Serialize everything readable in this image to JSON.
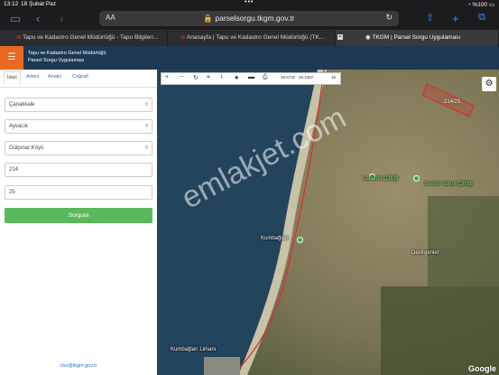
{
  "status": {
    "time": "13:12",
    "date": "18 Şubat Paz",
    "battery": "%100"
  },
  "browser": {
    "aa": "AA",
    "url": "parselsorgu.tkgm.gov.tr",
    "tabs": [
      "Tapu ve Kadastro Genel Müdürlüğü - Tapu Bilgileri...",
      "Anasayfa | Tapu ve Kadastro Genel Müdürlüğü (TK...",
      "TKGM | Parsel Sorgu Uygulaması"
    ]
  },
  "app": {
    "title_line1": "Tapu ve Kadastro Genel Müdürlüğü",
    "title_line2": "Parsel Sorgu Uygulaması"
  },
  "panel": {
    "tabs": [
      "İdari",
      "Adres",
      "Analiz",
      "Coğrafi"
    ],
    "il": "Çanakkale",
    "ilce": "Ayvacık",
    "mahalle": "Gülpınar Köyü",
    "ada": "214",
    "parsel": "25",
    "query_button": "Sorgula",
    "email": "cbs@tkgm.gov.tr"
  },
  "map": {
    "coords": "39.5732 : 26.1087",
    "zoom": "16",
    "parcel_label": "214/25",
    "places": [
      "Lavanta Çiftliği",
      "Sermin Tarım Çiftliği",
      "Kumbağları",
      "Devirgenler",
      "Kumbağları Limanı"
    ],
    "watermark": "emlakjet.com",
    "attribution": "Google"
  }
}
